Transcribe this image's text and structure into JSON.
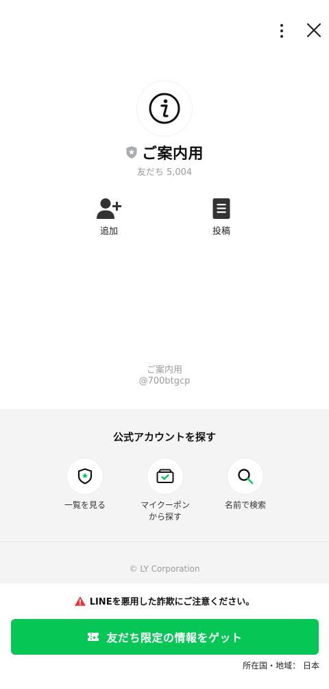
{
  "header": {
    "menu_icon": "more-vertical-icon",
    "close_icon": "close-icon"
  },
  "profile": {
    "avatar_icon": "info-icon",
    "badge_icon": "verified-shield-icon",
    "name": "ご案内用",
    "friends": "友だち 5,004"
  },
  "actions": [
    {
      "label": "追加",
      "icon": "add-friend-icon"
    },
    {
      "label": "投稿",
      "icon": "post-icon"
    }
  ],
  "account": {
    "name": "ご案内用",
    "id": "@700btgcp"
  },
  "find": {
    "title": "公式アカウントを探す",
    "items": [
      {
        "label": "一覧を見る",
        "icon": "shield-star-icon"
      },
      {
        "label_line1": "マイクーポン",
        "label_line2": "から探す",
        "icon": "coupon-icon"
      },
      {
        "label": "名前で検索",
        "icon": "search-icon"
      }
    ]
  },
  "footer": {
    "copyright": "© LY Corporation"
  },
  "bottom": {
    "warning": "LINEを悪用した詐欺にご注意ください。",
    "warning_icon": "alert-icon",
    "cta_label": "友だち限定の情報をゲット",
    "cta_icon": "ticket-icon",
    "region": "所在国・地域： 日本"
  },
  "colors": {
    "brand_green": "#06c755",
    "warning_red": "#e8343a",
    "gray_bg": "#f4f4f4"
  }
}
